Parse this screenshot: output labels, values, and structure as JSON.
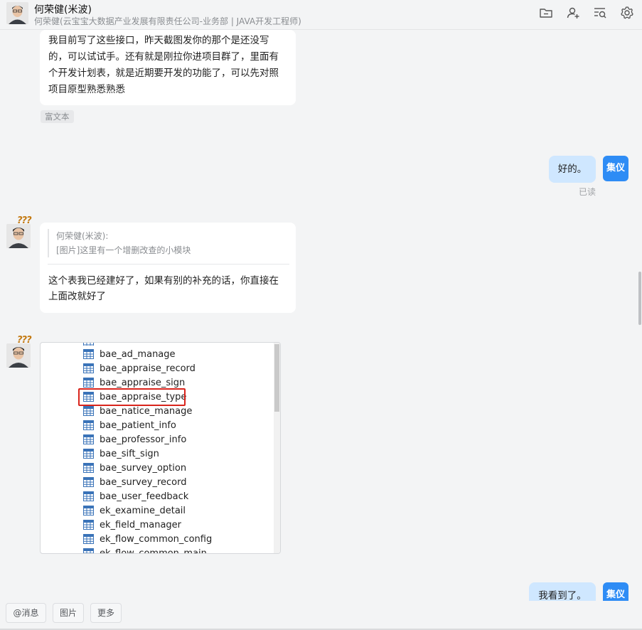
{
  "header": {
    "contact_name": "何荣健(米波)",
    "contact_subtitle": "何荣健(云宝宝大数据产业发展有限责任公司-业务部 | JAVA开发工程师)",
    "icons": [
      "folder-icon",
      "add-member-icon",
      "search-history-icon",
      "settings-icon"
    ]
  },
  "messages": {
    "m1": {
      "lines": [
        "我目前写了这些接口，昨天截图发你的那个是还没写",
        "的，可以试试手。还有就是刚拉你进项目群了，里面有",
        "个开发计划表，就是近期要开发的功能了，可以先对照",
        "项目原型熟悉熟悉"
      ],
      "tag": "富文本"
    },
    "m2": {
      "text": "好的。",
      "status": "已读",
      "avatar_text": "集仪"
    },
    "m3": {
      "quote_author": "何荣健(米波):",
      "quote_text": "[图片]这里有一个增删改查的小模块",
      "lines": [
        "这个表我已经建好了，如果有别的补充的话，你直接在",
        "上面改就好了"
      ],
      "qmarks": "???"
    },
    "m4": {
      "qmarks": "???",
      "tables": [
        "bae_ad_manage",
        "bae_appraise_record",
        "bae_appraise_sign",
        "bae_appraise_type",
        "bae_natice_manage",
        "bae_patient_info",
        "bae_professor_info",
        "bae_sift_sign",
        "bae_survey_option",
        "bae_survey_record",
        "bae_user_feedback",
        "ek_examine_detail",
        "ek_field_manager",
        "ek_flow_common_config",
        "ek_flow_common_main"
      ],
      "highlighted": "bae_appraise_type"
    },
    "m5": {
      "text": "我看到了。",
      "avatar_text": "集仪"
    }
  },
  "toolbar": {
    "mention_label": "@消息",
    "image_label": "图片",
    "more_label": "更多"
  },
  "colors": {
    "accent": "#2e8cf5",
    "my_bubble": "#cfe7ff",
    "highlight": "#d9241c"
  }
}
